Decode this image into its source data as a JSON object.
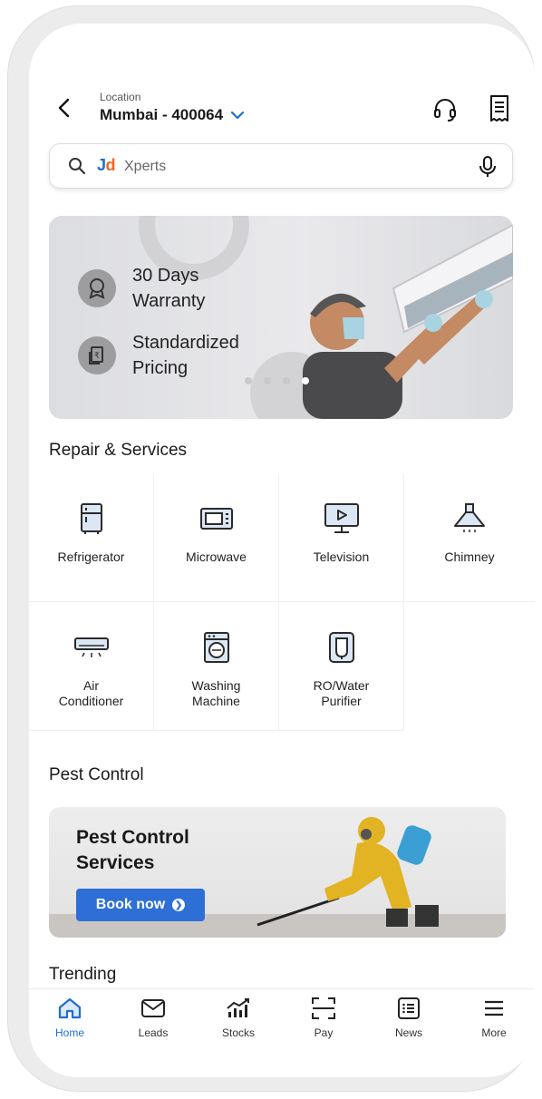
{
  "header": {
    "location_label": "Location",
    "location_value": "Mumbai - 400064"
  },
  "search": {
    "brand_j": "J",
    "brand_d": "d",
    "placeholder": "Xperts"
  },
  "banner": {
    "features": [
      {
        "icon": "award-badge-icon",
        "text_line1": "30 Days",
        "text_line2": "Warranty"
      },
      {
        "icon": "price-tag-icon",
        "text_line1": "Standardized",
        "text_line2": "Pricing"
      }
    ],
    "slide_count": 4,
    "active_slide": 4
  },
  "sections": {
    "repair_title": "Repair & Services",
    "pest_title": "Pest Control",
    "trending_title": "Trending"
  },
  "services": [
    {
      "label": "Refrigerator",
      "icon": "refrigerator-icon"
    },
    {
      "label": "Microwave",
      "icon": "microwave-icon"
    },
    {
      "label": "Television",
      "icon": "television-icon"
    },
    {
      "label": "Chimney",
      "icon": "chimney-icon"
    },
    {
      "label": "Air\nConditioner",
      "icon": "air-conditioner-icon"
    },
    {
      "label": "Washing\nMachine",
      "icon": "washing-machine-icon"
    },
    {
      "label": "RO/Water\nPurifier",
      "icon": "water-purifier-icon"
    }
  ],
  "pest_banner": {
    "title": "Pest Control Services",
    "button_label": "Book now"
  },
  "bottom_nav": [
    {
      "label": "Home",
      "icon": "home-icon",
      "active": true
    },
    {
      "label": "Leads",
      "icon": "mail-icon",
      "active": false
    },
    {
      "label": "Stocks",
      "icon": "stocks-chart-icon",
      "active": false
    },
    {
      "label": "Pay",
      "icon": "scan-icon",
      "active": false
    },
    {
      "label": "News",
      "icon": "news-icon",
      "active": false
    },
    {
      "label": "More",
      "icon": "menu-icon",
      "active": false
    }
  ],
  "colors": {
    "accent": "#1f6fd0",
    "brand_orange": "#f26522",
    "button_blue": "#2d6fd6"
  }
}
